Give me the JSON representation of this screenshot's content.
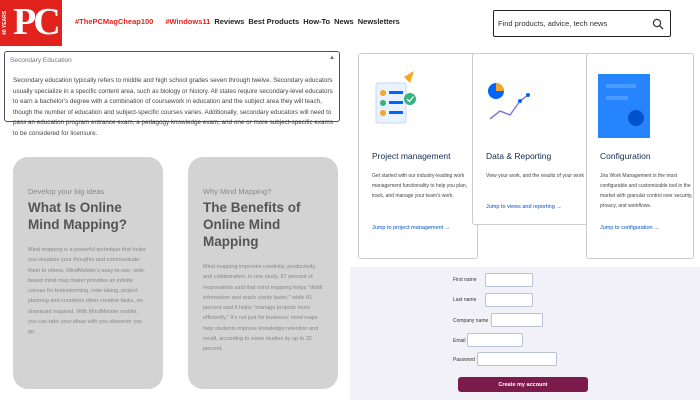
{
  "header": {
    "logo": {
      "text": "PC",
      "ribbon": "40 YEARS"
    },
    "nav": {
      "promo_links": [
        "#ThePCMagCheap100",
        "#Windows11"
      ],
      "links": [
        "Reviews",
        "Best Products",
        "How-To",
        "News",
        "Newsletters"
      ]
    },
    "search": {
      "placeholder": "Find products, advice, tech news",
      "icon": "search-icon"
    }
  },
  "accordion": {
    "title": "Secondary Education",
    "chevron_icon": "chevron-up-icon",
    "body": "Secondary education typically refers to middle and high school grades seven through twelve. Secondary educators usually specialize in a specific content area, such as biology or history. All states require secondary-level educators to earn a bachelor's degree with a combination of coursework in education and the subject area they will teach, though the number of education and subject-specific courses varies. Additionally, secondary educators will need to pass an education program entrance exam, a pedagogy knowledge exam, and one or more subject-specific exams to be considered for licensure."
  },
  "mind_cards": [
    {
      "kicker": "Develop your big ideas",
      "title": "What Is Online Mind Mapping?",
      "text": "Mind mapping is a powerful technique that helps you visualize your thoughts and communicate them to others. MindMeister's easy-to-use, web-based mind map maker provides an infinite canvas for brainstorming, note taking, project planning and countless other creative tasks, no download required. With MindMeister mobile, you can take your ideas with you wherever you go."
    },
    {
      "kicker": "Why Mind Mapping?",
      "title": "The Benefits of Online Mind Mapping",
      "text": "Mind mapping improves creativity, productivity and collaboration. In one study, 87 percent of respondents said that mind mapping helps \"distill information and reach clarity faster,\" while 81 percent said it helps \"manage projects more efficiently.\" It's not just for business: mind maps help students improve knowledge retention and recall, according to some studies by up to 32 percent."
    }
  ],
  "product_cards": [
    {
      "title": "Project management",
      "desc": "Get started with our industry-leading work management functionality to help you plan, track, and manage your team's work.",
      "link": "Jump to project management →"
    },
    {
      "title": "Data & Reporting",
      "desc": "View your work, and the results of your work",
      "link": "Jump to views and reporting →"
    },
    {
      "title": "Configuration",
      "desc": "Jira Work Management is the most configurable and customizable tool in the market with granular control over security, privacy, and workflows.",
      "link": "Jump to configuration →"
    }
  ],
  "signup_form": {
    "fields": [
      {
        "label": "First name",
        "value": ""
      },
      {
        "label": "Last name",
        "value": ""
      },
      {
        "label": "Company name",
        "value": ""
      },
      {
        "label": "Email",
        "value": ""
      },
      {
        "label": "Password",
        "value": ""
      }
    ],
    "submit_label": "Create my account"
  },
  "colors": {
    "brand_red": "#e2221d",
    "link_blue": "#0052cc",
    "button_plum": "#7b1b4c",
    "card_grey": "#d3d3d3"
  }
}
